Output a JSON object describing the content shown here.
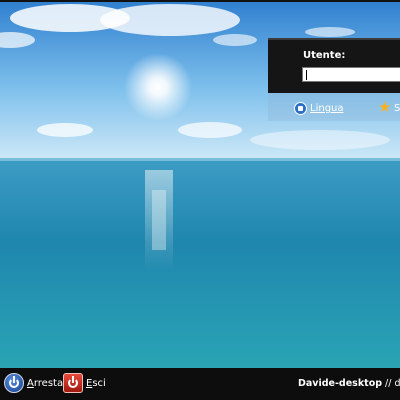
{
  "login": {
    "user_label": "Utente:",
    "user_value": ""
  },
  "options": {
    "language_label": "Lingua",
    "language_icon": "speech-bubble-globe-icon",
    "session_icon": "star-icon",
    "session_label": "S"
  },
  "bottom": {
    "shutdown_label_first": "A",
    "shutdown_label_rest": "rresta",
    "shutdown_icon": "power-button-icon",
    "quit_label_first": "E",
    "quit_label_rest": "sci",
    "quit_icon": "logout-icon",
    "hostname": "Davide-desktop",
    "separator": "//",
    "date_partial": "dom"
  },
  "colors": {
    "panel_bg": "#151515",
    "bar_bg": "#0d0d0d",
    "sea": "#1e7fa6",
    "sky": "#4aa3e0"
  }
}
